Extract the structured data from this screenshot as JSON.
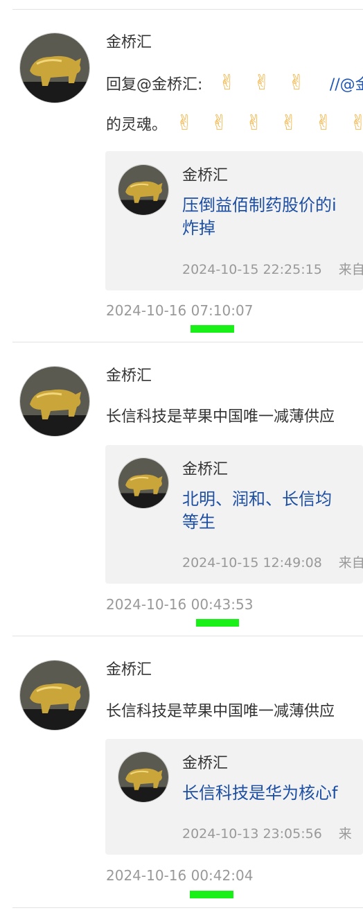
{
  "posts": [
    {
      "author": "金桥汇",
      "text_line1_prefix": "回复@金桥汇:",
      "text_line1_emojis": [
        "✌",
        "✌",
        "✌"
      ],
      "text_line1_mention": "//@金",
      "text_line2_prefix": "的灵魂。",
      "text_line2_emojis": [
        "✌",
        "✌",
        "✌",
        "✌",
        "✌",
        "✌"
      ],
      "quote": {
        "author": "金桥汇",
        "text_lines": [
          "压倒益佰制药股价的i",
          "炸掉"
        ],
        "time": "2024-10-15 22:25:15",
        "source": "来自"
      },
      "time": "2024-10-16 07:10:07"
    },
    {
      "author": "金桥汇",
      "text": "长信科技是苹果中国唯一减薄供应",
      "quote": {
        "author": "金桥汇",
        "text_lines": [
          "北明、润和、长信均",
          "等生"
        ],
        "time": "2024-10-15 12:49:08",
        "source": "来自"
      },
      "time": "2024-10-16 00:43:53"
    },
    {
      "author": "金桥汇",
      "text": "长信科技是苹果中国唯一减薄供应",
      "quote": {
        "author": "金桥汇",
        "text_lines": [
          "长信科技是华为核心f"
        ],
        "time": "2024-10-13 23:05:56",
        "source": "来"
      },
      "time": "2024-10-16 00:42:04"
    }
  ],
  "colors": {
    "link": "#1c4ea3",
    "timestamp": "#999999",
    "highlight": "#18f018",
    "quote_bg": "#f2f2f2"
  }
}
